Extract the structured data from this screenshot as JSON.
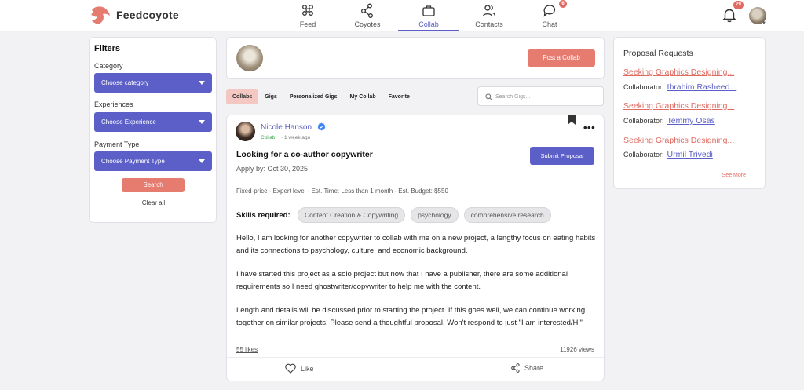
{
  "app": {
    "name": "Feedcoyote"
  },
  "nav": {
    "items": [
      {
        "label": "Feed",
        "icon": "feed-icon"
      },
      {
        "label": "Coyotes",
        "icon": "share-nodes-icon"
      },
      {
        "label": "Collab",
        "icon": "briefcase-icon",
        "active": true
      },
      {
        "label": "Contacts",
        "icon": "users-icon"
      },
      {
        "label": "Chat",
        "icon": "chat-icon",
        "badge": "6"
      }
    ]
  },
  "header": {
    "notifications_badge": "79"
  },
  "filters": {
    "title": "Filters",
    "category_label": "Category",
    "category_value": "Choose category",
    "experience_label": "Experiences",
    "experience_value": "Choose Experience",
    "payment_label": "Payment Type",
    "payment_value": "Choose Payment Type",
    "search_label": "Search",
    "clear_label": "Clear all"
  },
  "composer": {
    "post_button": "Post a Collab"
  },
  "tabs": [
    "Collabs",
    "Gigs",
    "Personalized Gigs",
    "My Collab",
    "Favorite"
  ],
  "search": {
    "placeholder": "Search Gigs..."
  },
  "post": {
    "author": "Nicole Hanson",
    "type": "Collab",
    "time": "· 1 week ago",
    "title": "Looking for a co-author copywriter",
    "apply_by": "Apply by: Oct 30, 2025",
    "submit_label": "Submit Proposal",
    "meta": "Fixed-price - Expert level - Est. Time: Less than 1 month - Est. Budget: $550",
    "skills_label": "Skills required:",
    "skills": [
      "Content Creation & Copywriting",
      "psychology",
      "comprehensive research"
    ],
    "paragraphs": [
      "Hello, I am looking for another copywriter to collab with me on a new project, a lengthy focus on eating habits and its connections to psychology, culture, and economic background.",
      "I have started this project as a solo project but now that I have a publisher, there are some additional requirements so I need ghostwriter/copywriter to help me with the content.",
      "Length and details will be discussed prior to starting the project. If this goes well, we can continue working together on similar projects. Please send a thoughtful proposal. Won't respond to just \"I am interested/Hi\""
    ],
    "likes": "55 likes",
    "views": "11926 views",
    "like_label": "Like",
    "share_label": "Share"
  },
  "proposals": {
    "title": "Proposal Requests",
    "collaborator_label": "Collaborator:",
    "items": [
      {
        "title": "Seeking Graphics Designing...",
        "collaborator": "Ibrahim Rasheed..."
      },
      {
        "title": "Seeking Graphics Designing...",
        "collaborator": "Temmy Osas"
      },
      {
        "title": "Seeking Graphics Designing...",
        "collaborator": "Urmil Trivedi"
      }
    ],
    "see_more": "See More"
  },
  "colors": {
    "accent": "#5b5fc7",
    "brand": "#e67b70",
    "verified": "#3b82f6"
  }
}
